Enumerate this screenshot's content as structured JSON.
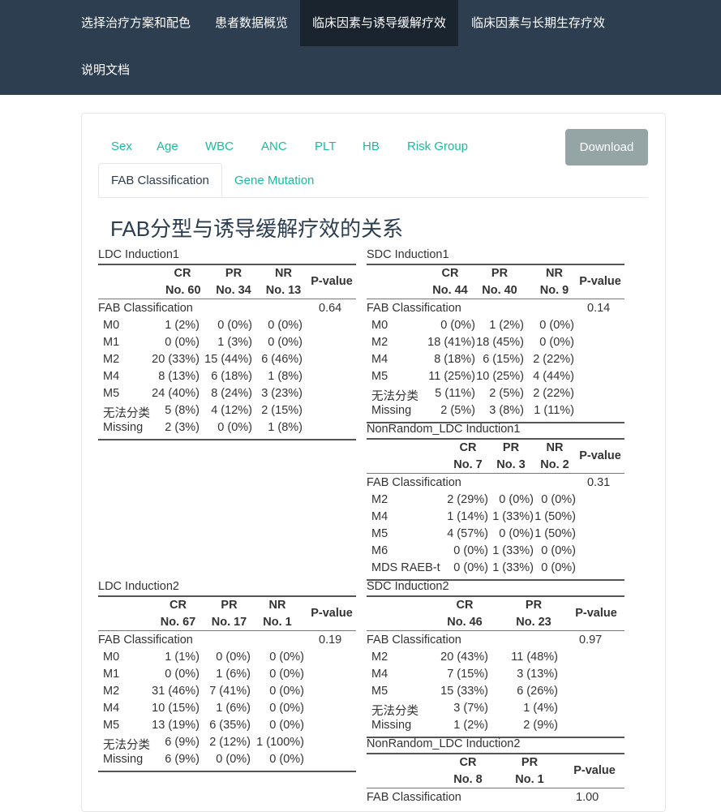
{
  "nav": {
    "items": [
      {
        "label": "选择治疗方案和配色"
      },
      {
        "label": "患者数据概览"
      },
      {
        "label": "临床因素与诱导缓解疗效"
      },
      {
        "label": "临床因素与长期生存疗效"
      },
      {
        "label": "说明文档"
      }
    ],
    "active_index": 2
  },
  "tabs": [
    {
      "label": "Sex"
    },
    {
      "label": "Age"
    },
    {
      "label": "WBC"
    },
    {
      "label": "ANC"
    },
    {
      "label": "PLT"
    },
    {
      "label": "HB"
    },
    {
      "label": "Risk Group"
    },
    {
      "label": "FAB Classification"
    },
    {
      "label": "Gene Mutation"
    }
  ],
  "active_tab": "FAB Classification",
  "download_label": "Download",
  "page_title": "FAB分型与诱导缓解疗效的关系",
  "colors": {
    "navbar": "#2c3e50",
    "nav_active": "#1a242f",
    "accent": "#18bc9c",
    "button": "#95a5a6"
  },
  "tables": [
    {
      "caption": "LDC Induction1",
      "columns": [
        {
          "name": "CR",
          "n": "No. 60"
        },
        {
          "name": "PR",
          "n": "No. 34"
        },
        {
          "name": "NR",
          "n": "No. 13"
        }
      ],
      "pvalue_header": "P-value",
      "group": "FAB Classification",
      "pvalue": "0.64",
      "rows": [
        {
          "label": "M0",
          "values": [
            "1 (2%)",
            "0 (0%)",
            "0 (0%)"
          ]
        },
        {
          "label": "M1",
          "values": [
            "0 (0%)",
            "1 (3%)",
            "0 (0%)"
          ]
        },
        {
          "label": "M2",
          "values": [
            "20 (33%)",
            "15 (44%)",
            "6 (46%)"
          ]
        },
        {
          "label": "M4",
          "values": [
            "8 (13%)",
            "6 (18%)",
            "1 (8%)"
          ]
        },
        {
          "label": "M5",
          "values": [
            "24 (40%)",
            "8 (24%)",
            "3 (23%)"
          ]
        },
        {
          "label": "无法分类",
          "values": [
            "5 (8%)",
            "4 (12%)",
            "2 (15%)"
          ]
        },
        {
          "label": "Missing",
          "values": [
            "2 (3%)",
            "0 (0%)",
            "1 (8%)"
          ]
        }
      ]
    },
    {
      "caption": "SDC Induction1",
      "columns": [
        {
          "name": "CR",
          "n": "No. 44"
        },
        {
          "name": "PR",
          "n": "No. 40"
        },
        {
          "name": "NR",
          "n": "No. 9"
        }
      ],
      "pvalue_header": "P-value",
      "group": "FAB Classification",
      "pvalue": "0.14",
      "rows": [
        {
          "label": "M0",
          "values": [
            "0 (0%)",
            "1 (2%)",
            "0 (0%)"
          ]
        },
        {
          "label": "M2",
          "values": [
            "18 (41%)",
            "18 (45%)",
            "0 (0%)"
          ]
        },
        {
          "label": "M4",
          "values": [
            "8 (18%)",
            "6 (15%)",
            "2 (22%)"
          ]
        },
        {
          "label": "M5",
          "values": [
            "11 (25%)",
            "10 (25%)",
            "4 (44%)"
          ]
        },
        {
          "label": "无法分类",
          "values": [
            "5 (11%)",
            "2 (5%)",
            "2 (22%)"
          ]
        },
        {
          "label": "Missing",
          "values": [
            "2 (5%)",
            "3 (8%)",
            "1 (11%)"
          ]
        }
      ]
    },
    {
      "caption": "NonRandom_LDC Induction1",
      "columns": [
        {
          "name": "CR",
          "n": "No. 7"
        },
        {
          "name": "PR",
          "n": "No. 3"
        },
        {
          "name": "NR",
          "n": "No. 2"
        }
      ],
      "pvalue_header": "P-value",
      "group": "FAB Classification",
      "pvalue": "0.31",
      "rows": [
        {
          "label": "M2",
          "values": [
            "2 (29%)",
            "0 (0%)",
            "0 (0%)"
          ]
        },
        {
          "label": "M4",
          "values": [
            "1 (14%)",
            "1 (33%)",
            "1 (50%)"
          ]
        },
        {
          "label": "M5",
          "values": [
            "4 (57%)",
            "0 (0%)",
            "1 (50%)"
          ]
        },
        {
          "label": "M6",
          "values": [
            "0 (0%)",
            "1 (33%)",
            "0 (0%)"
          ]
        },
        {
          "label": "MDS RAEB-t",
          "values": [
            "0 (0%)",
            "1 (33%)",
            "0 (0%)"
          ]
        }
      ]
    },
    {
      "caption": "LDC Induction2",
      "columns": [
        {
          "name": "CR",
          "n": "No. 67"
        },
        {
          "name": "PR",
          "n": "No. 17"
        },
        {
          "name": "NR",
          "n": "No. 1"
        }
      ],
      "pvalue_header": "P-value",
      "group": "FAB Classification",
      "pvalue": "0.19",
      "rows": [
        {
          "label": "M0",
          "values": [
            "1 (1%)",
            "0 (0%)",
            "0 (0%)"
          ]
        },
        {
          "label": "M1",
          "values": [
            "0 (0%)",
            "1 (6%)",
            "0 (0%)"
          ]
        },
        {
          "label": "M2",
          "values": [
            "31 (46%)",
            "7 (41%)",
            "0 (0%)"
          ]
        },
        {
          "label": "M4",
          "values": [
            "10 (15%)",
            "1 (6%)",
            "0 (0%)"
          ]
        },
        {
          "label": "M5",
          "values": [
            "13 (19%)",
            "6 (35%)",
            "0 (0%)"
          ]
        },
        {
          "label": "无法分类",
          "values": [
            "6 (9%)",
            "2 (12%)",
            "1 (100%)"
          ]
        },
        {
          "label": "Missing",
          "values": [
            "6 (9%)",
            "0 (0%)",
            "0 (0%)"
          ]
        }
      ]
    },
    {
      "caption": "SDC Induction2",
      "columns": [
        {
          "name": "CR",
          "n": "No. 46"
        },
        {
          "name": "PR",
          "n": "No. 23"
        }
      ],
      "pvalue_header": "P-value",
      "group": "FAB Classification",
      "pvalue": "0.97",
      "rows": [
        {
          "label": "M2",
          "values": [
            "20 (43%)",
            "11 (48%)"
          ]
        },
        {
          "label": "M4",
          "values": [
            "7 (15%)",
            "3 (13%)"
          ]
        },
        {
          "label": "M5",
          "values": [
            "15 (33%)",
            "6 (26%)"
          ]
        },
        {
          "label": "无法分类",
          "values": [
            "3 (7%)",
            "1 (4%)"
          ]
        },
        {
          "label": "Missing",
          "values": [
            "1 (2%)",
            "2 (9%)"
          ]
        }
      ]
    },
    {
      "caption": "NonRandom_LDC Induction2",
      "columns": [
        {
          "name": "CR",
          "n": "No. 8"
        },
        {
          "name": "PR",
          "n": "No. 1"
        }
      ],
      "pvalue_header": "P-value",
      "group": "FAB Classification",
      "pvalue": "1.00",
      "rows": []
    }
  ]
}
